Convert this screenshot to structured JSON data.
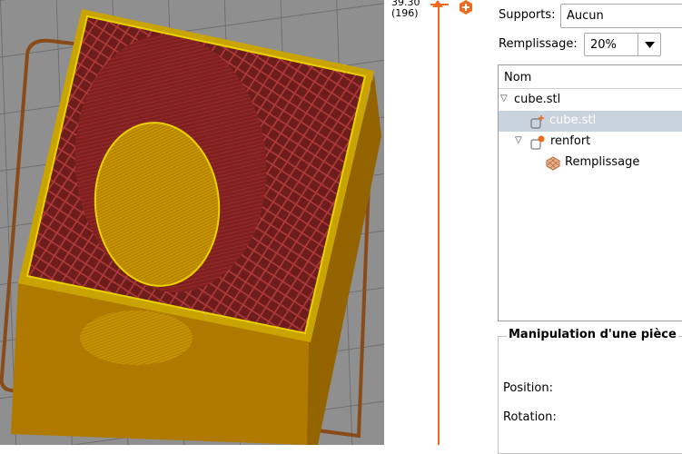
{
  "slider": {
    "top_value": "39.30",
    "top_layer": "(196)"
  },
  "panel": {
    "supports_label": "Supports:",
    "supports_value": "Aucun",
    "infill_label": "Remplissage:",
    "infill_value": "20%",
    "tree": {
      "column_header": "Nom",
      "items": [
        {
          "label": "cube.stl"
        },
        {
          "label": "cube.stl"
        },
        {
          "label": "renfort"
        },
        {
          "label": "Remplissage"
        }
      ]
    },
    "manipulation": {
      "title": "Manipulation d'une pièce",
      "position_label": "Position:",
      "rotation_label": "Rotation:"
    }
  },
  "colors": {
    "accent": "#ed6b21",
    "model_wall": "#c38a00",
    "infill": "#7a1f1f",
    "selection": "#c9d3dd"
  }
}
